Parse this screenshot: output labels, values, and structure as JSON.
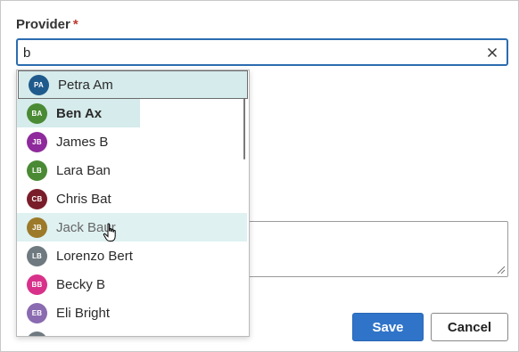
{
  "form": {
    "provider_label": "Provider",
    "required_mark": "*",
    "provider_value": "b",
    "save_label": "Save",
    "cancel_label": "Cancel"
  },
  "dropdown": {
    "options": [
      {
        "initials": "PA",
        "name": "Petra Am",
        "color": "#1f5a8c",
        "state": "outlined"
      },
      {
        "initials": "BA",
        "name": "Ben Ax",
        "color": "#4a8a34",
        "state": "highlighted"
      },
      {
        "initials": "JB",
        "name": "James B",
        "color": "#8e2a9b",
        "state": ""
      },
      {
        "initials": "LB",
        "name": "Lara Ban",
        "color": "#4a8a34",
        "state": ""
      },
      {
        "initials": "CB",
        "name": "Chris Bat",
        "color": "#7a1d2a",
        "state": ""
      },
      {
        "initials": "JB",
        "name": "Jack Baur",
        "color": "#9c7a2a",
        "state": "hovered"
      },
      {
        "initials": "LB",
        "name": "Lorenzo Bert",
        "color": "#6e7a80",
        "state": ""
      },
      {
        "initials": "BB",
        "name": "Becky B",
        "color": "#d8318a",
        "state": ""
      },
      {
        "initials": "EB",
        "name": "Eli Bright",
        "color": "#8a6ab0",
        "state": ""
      },
      {
        "initials": "",
        "name": "",
        "color": "#6e7a80",
        "state": "partial"
      }
    ]
  },
  "colors": {
    "accent": "#2f74c9",
    "required": "#c0392b",
    "highlight": "#d6ebeb"
  }
}
